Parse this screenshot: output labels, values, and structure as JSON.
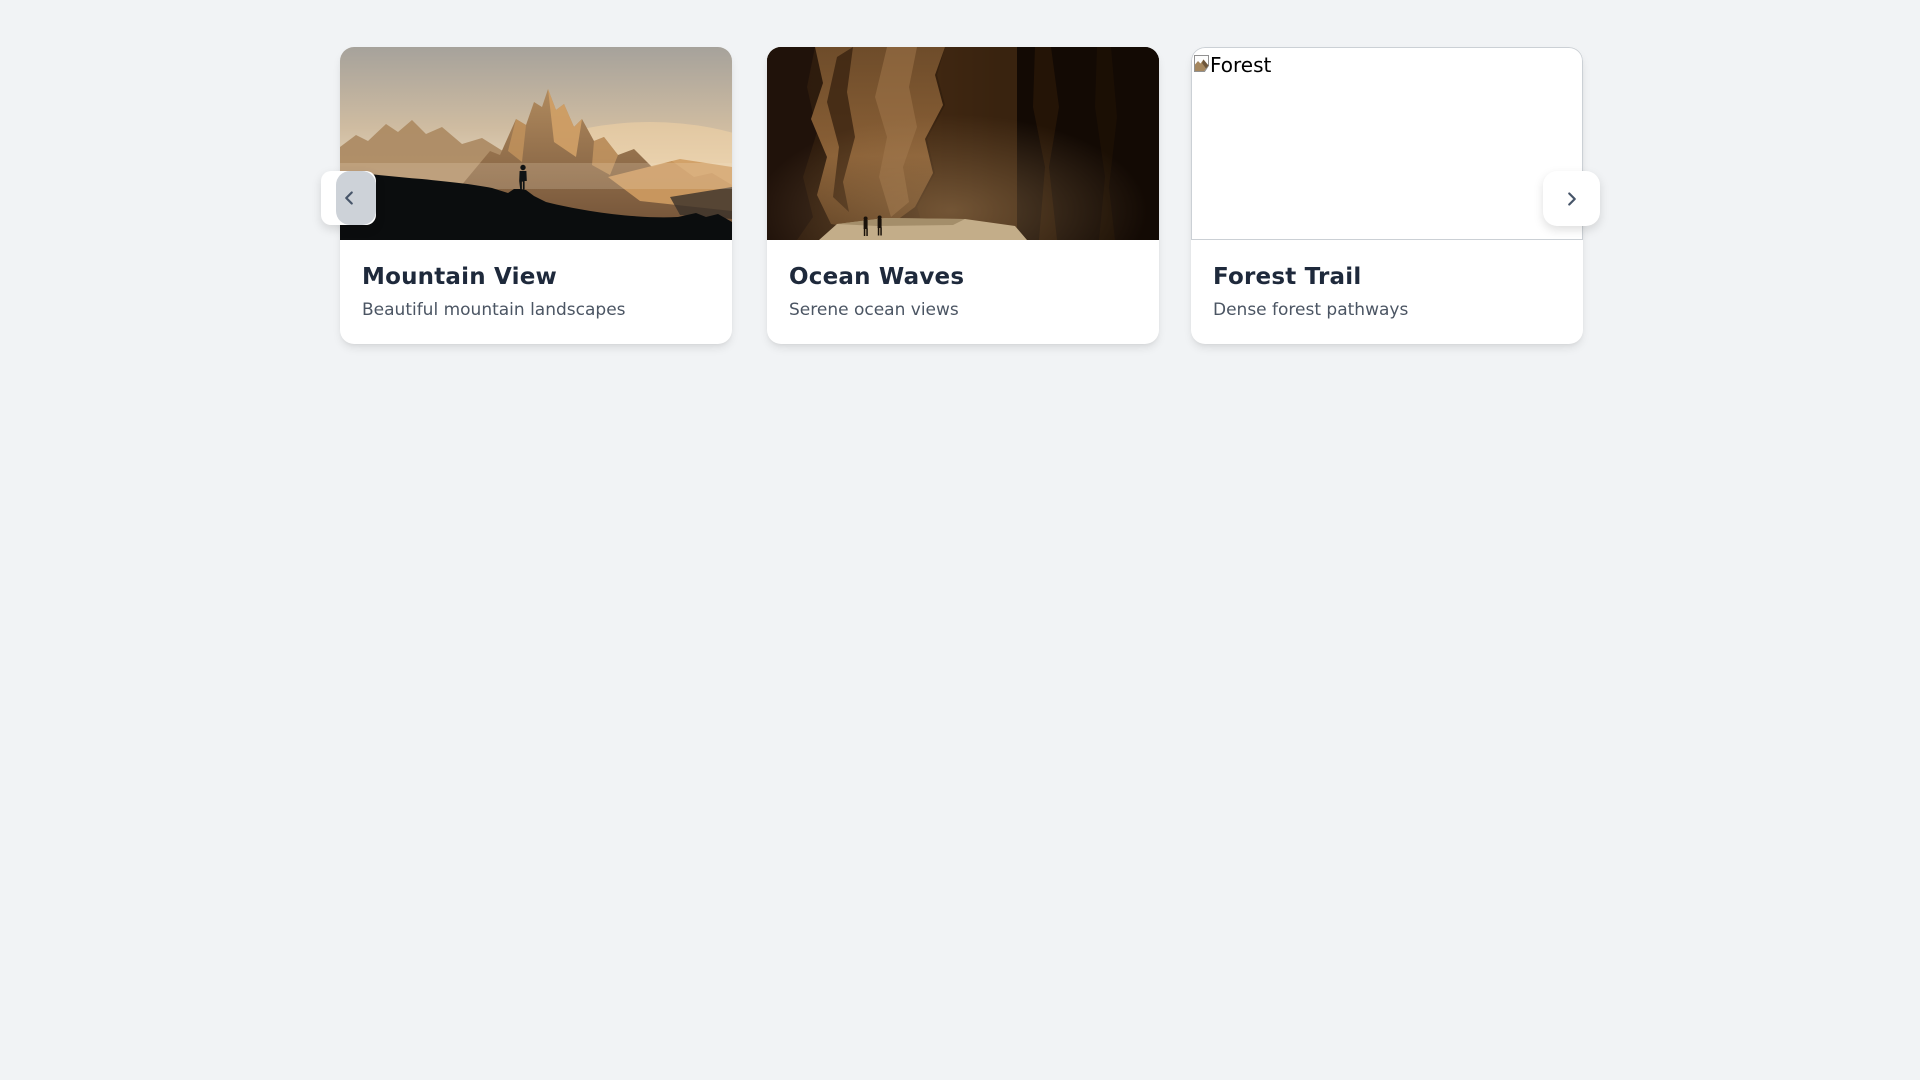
{
  "page": {
    "background_color": "#f1f3f5"
  },
  "carousel": {
    "prev_button": {
      "icon": "chevron-left",
      "background_color": "#cdd2d8"
    },
    "next_button": {
      "icon": "chevron-right",
      "background_color": "#ffffff"
    },
    "cards": [
      {
        "title": "Mountain View",
        "description": "Beautiful mountain landscapes",
        "image": "mountain landscape photo, hiker silhouette at dusk"
      },
      {
        "title": "Ocean Waves",
        "description": "Serene ocean views",
        "image": "dark canyon gorge photo with two tiny hikers"
      },
      {
        "title": "Forest Trail",
        "description": "Dense forest pathways",
        "image_broken": true,
        "image_alt": "Forest"
      }
    ],
    "colors": {
      "card_background": "#ffffff",
      "title_text": "#1e293b",
      "description_text": "#4b5563",
      "chevron": "#475569",
      "broken_image_border": "#cbd0d5"
    }
  }
}
